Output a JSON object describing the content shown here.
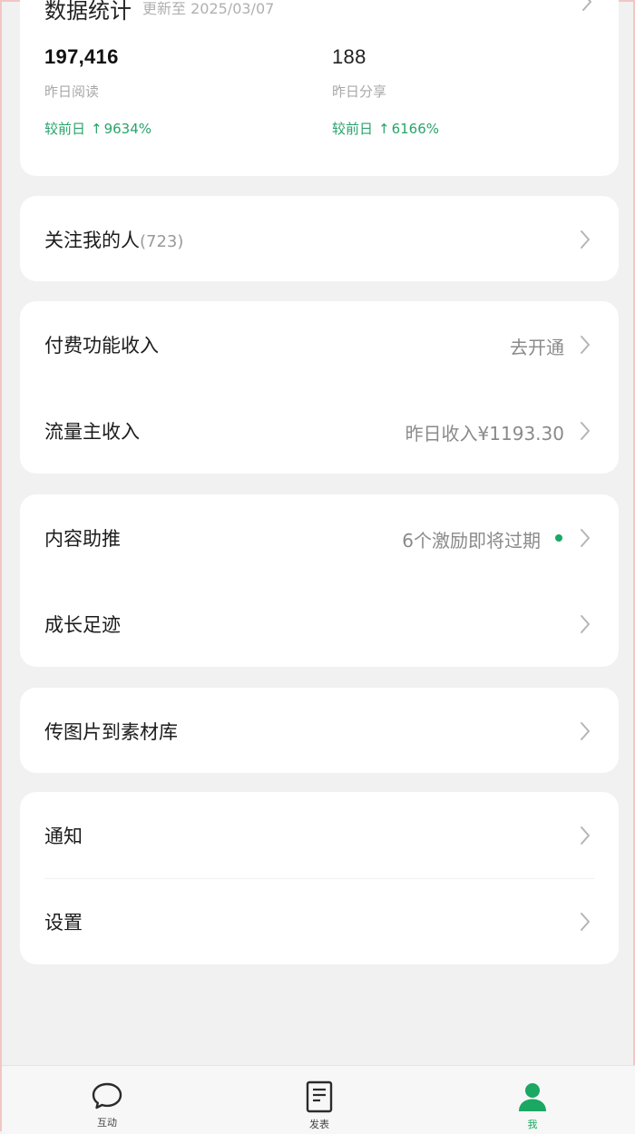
{
  "stats": {
    "title": "数据统计",
    "updated": "更新至 2025/03/07",
    "metrics": [
      {
        "value": "197,416",
        "label": "昨日阅读",
        "change_prefix": "较前日",
        "change_value": "9634%"
      },
      {
        "value": "188",
        "label": "昨日分享",
        "change_prefix": "较前日",
        "change_value": "6166%"
      }
    ]
  },
  "followers": {
    "label": "关注我的人",
    "count": "(723)"
  },
  "income": {
    "paid": {
      "label": "付费功能收入",
      "action": "去开通"
    },
    "traffic": {
      "label": "流量主收入",
      "value": "昨日收入¥1193.30"
    }
  },
  "growth": {
    "promote": {
      "label": "内容助推",
      "value": "6个激励即将过期"
    },
    "footprint": {
      "label": "成长足迹"
    }
  },
  "material": {
    "label": "传图片到素材库"
  },
  "system": {
    "notify": {
      "label": "通知"
    },
    "settings": {
      "label": "设置"
    }
  },
  "nav": {
    "items": [
      {
        "label": "互动",
        "icon": "chat-bubble-icon",
        "active": false
      },
      {
        "label": "发表",
        "icon": "document-icon",
        "active": false
      },
      {
        "label": "我",
        "icon": "person-icon",
        "active": true
      }
    ]
  },
  "colors": {
    "accent": "#1aa863",
    "background": "#f1f1f1",
    "card": "#ffffff"
  }
}
